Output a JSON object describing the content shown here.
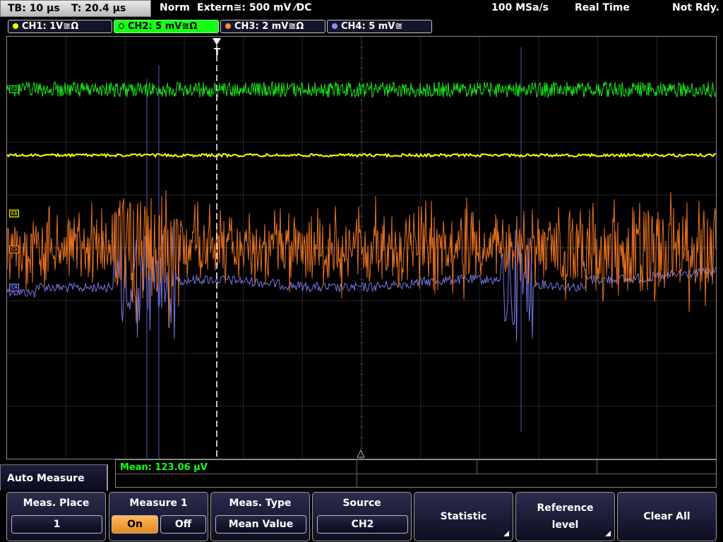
{
  "status_bar": {
    "timebase": "TB: 10 µs",
    "trigger_time": "T: 20.4 µs",
    "trigger_mode": "Norm",
    "trigger_source": "Extern≅: 500 mV ⁄DC",
    "sample_rate": "100 MSa/s",
    "acq_mode": "Real Time",
    "status": "Not Rdy."
  },
  "channels": [
    {
      "label": "CH1: 1V≅Ω",
      "color": "#ffff00"
    },
    {
      "label": "CH2: 5 mV≅Ω",
      "color": "#14ff14"
    },
    {
      "label": "CH3: 2 mV≅Ω",
      "color": "#ff8c28"
    },
    {
      "label": "CH4: 5 mV≅",
      "color": "#8c8cff"
    }
  ],
  "markers": {
    "c2": "C2",
    "c1": "C1",
    "c3": "C3",
    "c4": "C4"
  },
  "measurement": {
    "result": "Mean: 123.06 µV"
  },
  "menu": {
    "title": "Auto Measure",
    "meas_place": {
      "label": "Meas. Place",
      "value": "1"
    },
    "measure": {
      "label": "Measure 1",
      "on": "On",
      "off": "Off"
    },
    "meas_type": {
      "label": "Meas. Type",
      "value": "Mean Value"
    },
    "source": {
      "label": "Source",
      "value": "CH2"
    },
    "statistic": "Statistic",
    "ref_level_line1": "Reference",
    "ref_level_line2": "level",
    "clear_all": "Clear All"
  }
}
